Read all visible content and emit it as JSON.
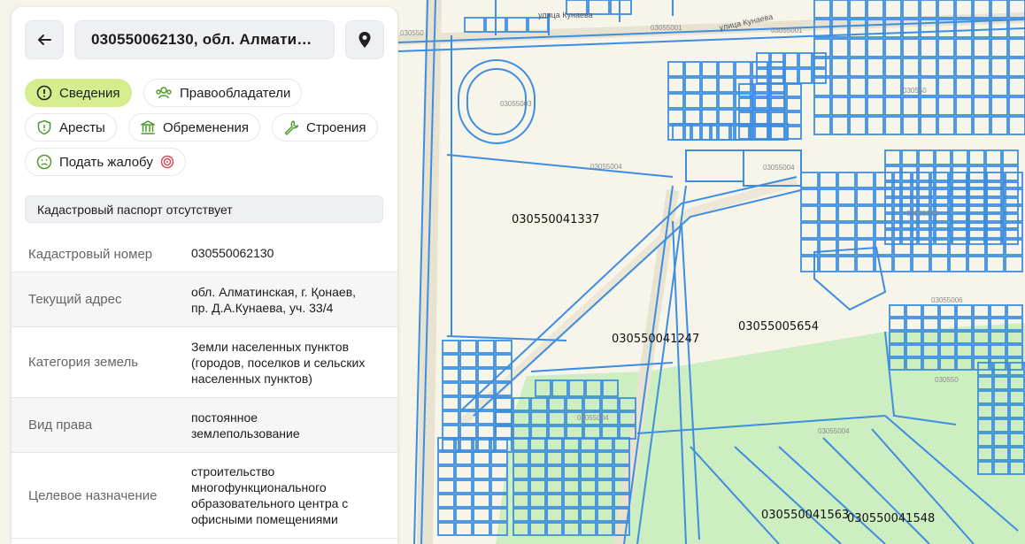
{
  "header": {
    "title": "030550062130, обл. Алмати…"
  },
  "tabs": [
    {
      "label": "Сведения",
      "icon": "info-circle-icon",
      "active": true
    },
    {
      "label": "Правообладатели",
      "icon": "people-icon",
      "active": false
    },
    {
      "label": "Аресты",
      "icon": "shield-icon",
      "active": false
    },
    {
      "label": "Обременения",
      "icon": "bank-building-icon",
      "active": false
    },
    {
      "label": "Строения",
      "icon": "wrench-icon",
      "active": false
    },
    {
      "label": "Подать жалобу",
      "icon": "sad-face-icon",
      "active": false
    }
  ],
  "notice": "Кадастровый паспорт отсутствует",
  "details": [
    {
      "key": "Кадастровый номер",
      "value": "030550062130"
    },
    {
      "key": "Текущий адрес",
      "value_lines": [
        "обл. Алматинская, г. Қонаев,",
        "пр. Д.А.Кунаева, уч. 33/4"
      ]
    },
    {
      "key": "Категория земель",
      "value_lines": [
        "Земли населенных пунктов",
        "(городов, поселков и сельских",
        "населенных пунктов)"
      ]
    },
    {
      "key": "Вид права",
      "value_lines": [
        "постоянное",
        "землепользование"
      ]
    },
    {
      "key": "Целевое назначение",
      "value_lines": [
        "строительство",
        "многофункционального",
        "образовательного центра с",
        "офисными помещениями"
      ]
    }
  ],
  "map": {
    "parcel_labels": [
      "030550041337",
      "030550041247",
      "03055005654",
      "030550041563",
      "030550041548"
    ],
    "quarter_labels": [
      "030550",
      "03055001",
      "03055004",
      "03055004",
      "03055006",
      "03055006",
      "03055003",
      "03055004",
      "030550",
      "03055004",
      "030550",
      "03055001"
    ],
    "streets": [
      "улица Кунаева",
      "улица Кунаева"
    ],
    "colors": {
      "parcel_line": "#3d8ee0",
      "green_zone": "#cdeec0",
      "background": "#f7f4ea",
      "accent_chip": "#d4ee8d"
    }
  }
}
